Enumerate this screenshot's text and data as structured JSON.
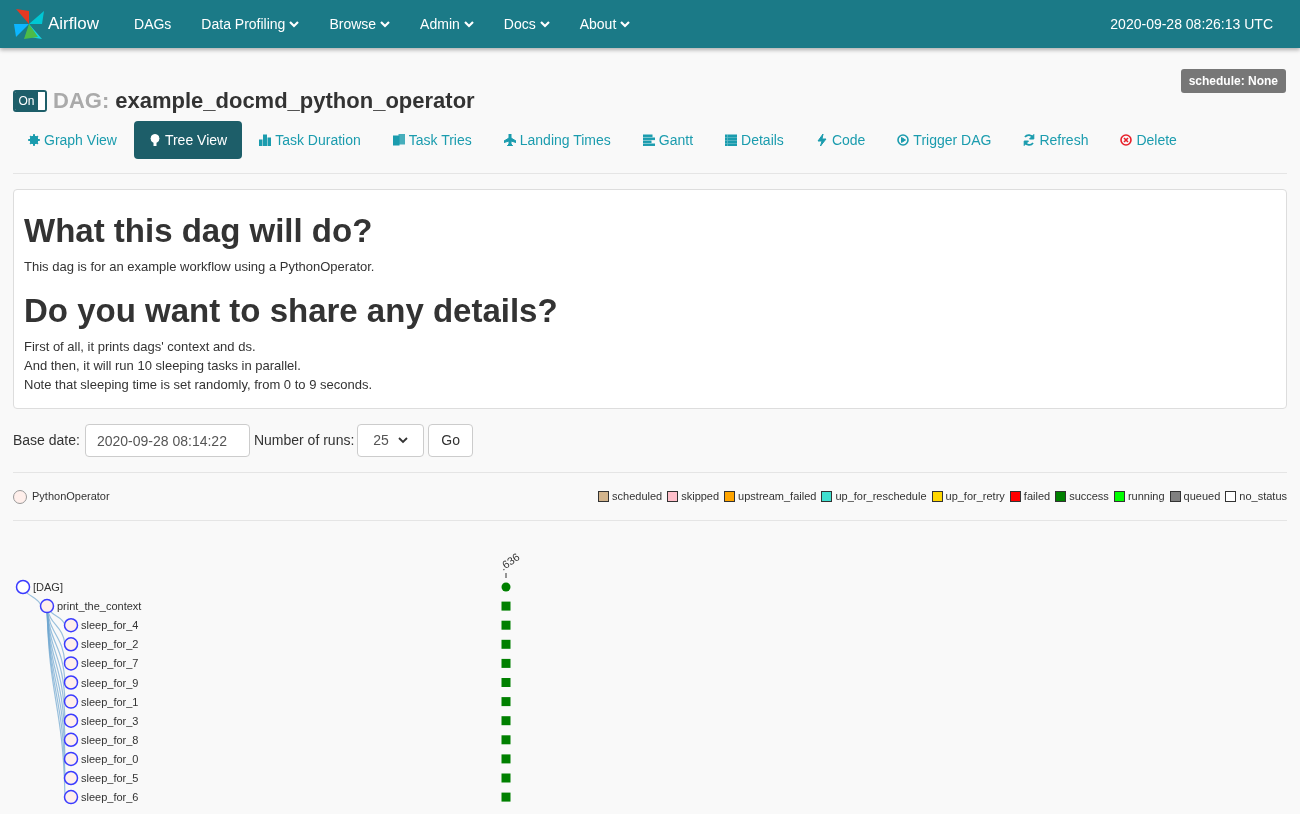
{
  "navbar": {
    "brand": "Airflow",
    "items": [
      {
        "label": "DAGs",
        "dropdown": false
      },
      {
        "label": "Data Profiling",
        "dropdown": true
      },
      {
        "label": "Browse",
        "dropdown": true
      },
      {
        "label": "Admin",
        "dropdown": true
      },
      {
        "label": "Docs",
        "dropdown": true
      },
      {
        "label": "About",
        "dropdown": true
      }
    ],
    "clock": "2020-09-28 08:26:13 UTC"
  },
  "dag": {
    "toggle": {
      "label": "On",
      "on": true
    },
    "prefix": "DAG:",
    "name": "example_docmd_python_operator",
    "schedule": "schedule: None"
  },
  "tabs": [
    {
      "label": "Graph View",
      "selected": false,
      "kind": "normal"
    },
    {
      "label": "Tree View",
      "selected": true,
      "kind": "normal"
    },
    {
      "label": "Task Duration",
      "selected": false,
      "kind": "normal"
    },
    {
      "label": "Task Tries",
      "selected": false,
      "kind": "normal"
    },
    {
      "label": "Landing Times",
      "selected": false,
      "kind": "normal"
    },
    {
      "label": "Gantt",
      "selected": false,
      "kind": "normal"
    },
    {
      "label": "Details",
      "selected": false,
      "kind": "normal"
    },
    {
      "label": "Code",
      "selected": false,
      "kind": "normal"
    },
    {
      "label": "Trigger DAG",
      "selected": false,
      "kind": "normal"
    },
    {
      "label": "Refresh",
      "selected": false,
      "kind": "normal"
    },
    {
      "label": "Delete",
      "selected": false,
      "kind": "danger"
    }
  ],
  "doc": [
    {
      "kind": "heading",
      "text": "What this dag will do?"
    },
    {
      "kind": "para",
      "text": "This dag is for an example workflow using a PythonOperator."
    },
    {
      "kind": "heading",
      "text": "Do you want to share any details?"
    },
    {
      "kind": "para",
      "text": "First of all, it prints dags' context and ds."
    },
    {
      "kind": "para",
      "text": "And then, it will run 10 sleeping tasks in parallel."
    },
    {
      "kind": "para",
      "text": "Note that sleeping time is set randomly, from 0 to 9 seconds."
    }
  ],
  "form": {
    "base_date_label": "Base date:",
    "base_date": "2020-09-28 08:14:22",
    "runs_label": "Number of runs:",
    "runs": "25",
    "go": "Go"
  },
  "operators": [
    {
      "label": "PythonOperator",
      "color": "#ffefeb"
    }
  ],
  "legend": [
    {
      "label": "scheduled",
      "color": "#d2b48c"
    },
    {
      "label": "skipped",
      "color": "#ffc0cb"
    },
    {
      "label": "upstream_failed",
      "color": "#ffa500"
    },
    {
      "label": "up_for_reschedule",
      "color": "#40e0d0"
    },
    {
      "label": "up_for_retry",
      "color": "#ffd700"
    },
    {
      "label": "failed",
      "color": "#ff0000"
    },
    {
      "label": "success",
      "color": "#008000"
    },
    {
      "label": "running",
      "color": "#00ff00"
    },
    {
      "label": "queued",
      "color": "#808080"
    },
    {
      "label": "no_status",
      "color": "#ffffff"
    }
  ],
  "tree": {
    "run_label": ".636",
    "root": {
      "label": "[DAG]",
      "color": "#008000",
      "children": [
        {
          "label": "print_the_context",
          "color": "#008000",
          "children": [
            {
              "label": "sleep_for_4",
              "color": "#008000"
            },
            {
              "label": "sleep_for_2",
              "color": "#008000"
            },
            {
              "label": "sleep_for_7",
              "color": "#008000"
            },
            {
              "label": "sleep_for_9",
              "color": "#008000"
            },
            {
              "label": "sleep_for_1",
              "color": "#008000"
            },
            {
              "label": "sleep_for_3",
              "color": "#008000"
            },
            {
              "label": "sleep_for_8",
              "color": "#008000"
            },
            {
              "label": "sleep_for_0",
              "color": "#008000"
            },
            {
              "label": "sleep_for_5",
              "color": "#008000"
            },
            {
              "label": "sleep_for_6",
              "color": "#008000"
            }
          ]
        }
      ]
    }
  }
}
